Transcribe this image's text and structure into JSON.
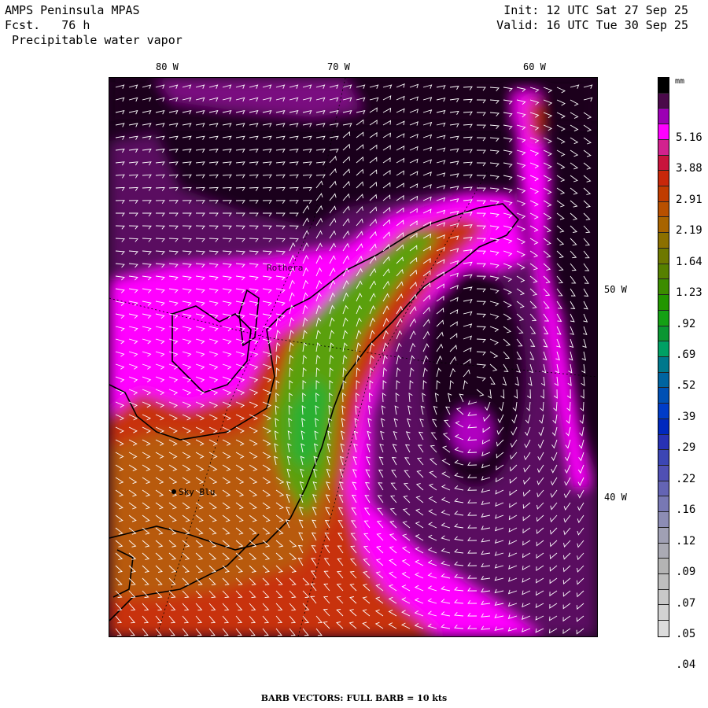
{
  "header": {
    "model": "AMPS Peninsula MPAS",
    "forecast_label": "Fcst.",
    "forecast_hours": "76 h",
    "field": "Precipitable water vapor",
    "init": "Init: 12 UTC Sat 27 Sep 25",
    "valid": "Valid: 16 UTC Tue 30 Sep 25"
  },
  "longitude_labels": [
    "80 W",
    "70 W",
    "60 W"
  ],
  "latitude_labels": [
    "50 W",
    "40 W"
  ],
  "colorbar": {
    "unit": "mm",
    "labels": [
      "5.16",
      "3.88",
      "2.91",
      "2.19",
      "1.64",
      "1.23",
      ".92",
      ".69",
      ".52",
      ".39",
      ".29",
      ".22",
      ".16",
      ".12",
      ".09",
      ".07",
      ".05",
      ".04"
    ],
    "colors": [
      "#000000",
      "#4a0a4a",
      "#9c00b4",
      "#ff00ff",
      "#d2228e",
      "#c8143c",
      "#c8280a",
      "#c03c00",
      "#b85000",
      "#a86400",
      "#8c7000",
      "#6e7800",
      "#568000",
      "#3c8c00",
      "#229600",
      "#14a014",
      "#0a9632",
      "#00a064",
      "#00788c",
      "#0064a0",
      "#0050b4",
      "#003cc8",
      "#0028be",
      "#2832b4",
      "#3c46b4",
      "#5050b4",
      "#6464b4",
      "#7878b4",
      "#8c8cb4",
      "#a0a0b4",
      "#aaaab4",
      "#b4b4b4",
      "#bebebe",
      "#c8c8c8",
      "#d2d2d2",
      "#dcdcdc"
    ]
  },
  "stations": [
    {
      "name": "Sky Blu"
    },
    {
      "name": "Rothera"
    }
  ],
  "footer": "BARB VECTORS:  FULL BARB = 10 kts"
}
